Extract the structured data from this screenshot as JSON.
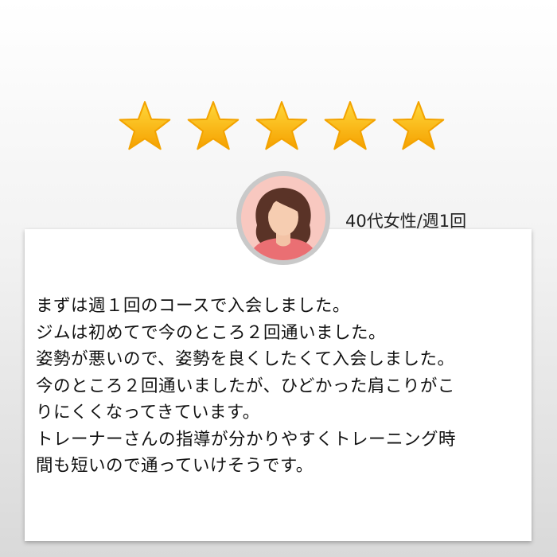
{
  "rating": {
    "value": 5,
    "max": 5,
    "star_color": "#f9b200",
    "star_icon": "star-icon"
  },
  "reviewer": {
    "label": "40代女性/週1回",
    "avatar_icon": "woman-avatar-icon"
  },
  "review": {
    "lines": [
      "まずは週１回のコースで入会しました。",
      "ジムは初めてで今のところ２回通いました。",
      "姿勢が悪いので、姿勢を良くしたくて入会しました。",
      "今のところ２回通いましたが、ひどかった肩こりがこ",
      "りにくくなってきています。",
      "トレーナーさんの指導が分かりやすくトレーニング時",
      "間も短いので通っていけそうです。"
    ]
  }
}
